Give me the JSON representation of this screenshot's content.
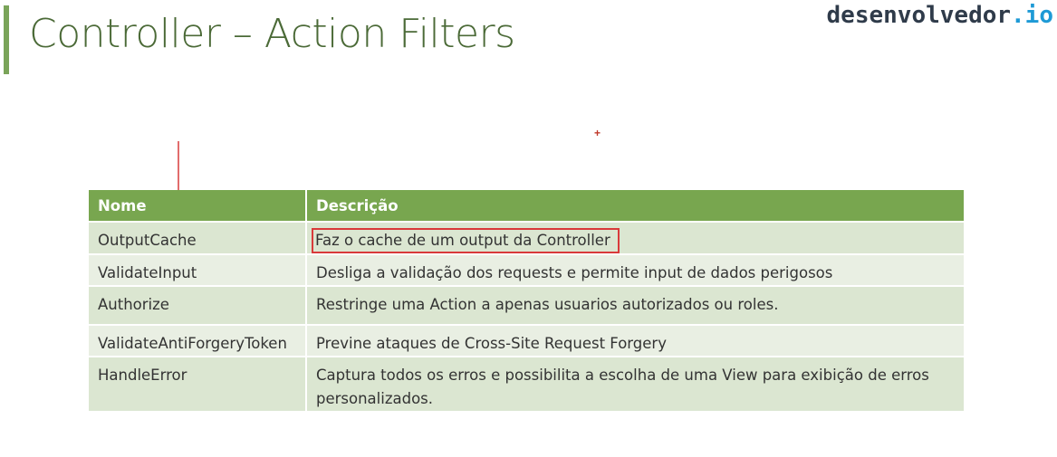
{
  "slide": {
    "title": "Controller – Action Filters",
    "logo_main": "desenvolvedor",
    "logo_suffix": ".io",
    "cursor_glyph": "+"
  },
  "table": {
    "headers": [
      "Nome",
      "Descrição"
    ],
    "rows": [
      {
        "name": "OutputCache",
        "description": "Faz o cache de um output da Controller"
      },
      {
        "name": "ValidateInput",
        "description": "Desliga a validação dos requests e permite input de dados perigosos"
      },
      {
        "name": "Authorize",
        "description": "Restringe uma Action a apenas usuarios autorizados ou roles."
      },
      {
        "name": "ValidateAntiForgeryToken",
        "description": "Previne ataques de Cross-Site Request Forgery"
      },
      {
        "name": "HandleError",
        "description": "Captura todos os erros e possibilita a escolha de uma View para exibição de erros personalizados."
      }
    ]
  },
  "colors": {
    "accent_green": "#78a64f",
    "title_green": "#4b6a37",
    "annotation_red": "#d93a3a",
    "logo_dark": "#2f3b4a",
    "logo_blue": "#1e9ad6"
  }
}
